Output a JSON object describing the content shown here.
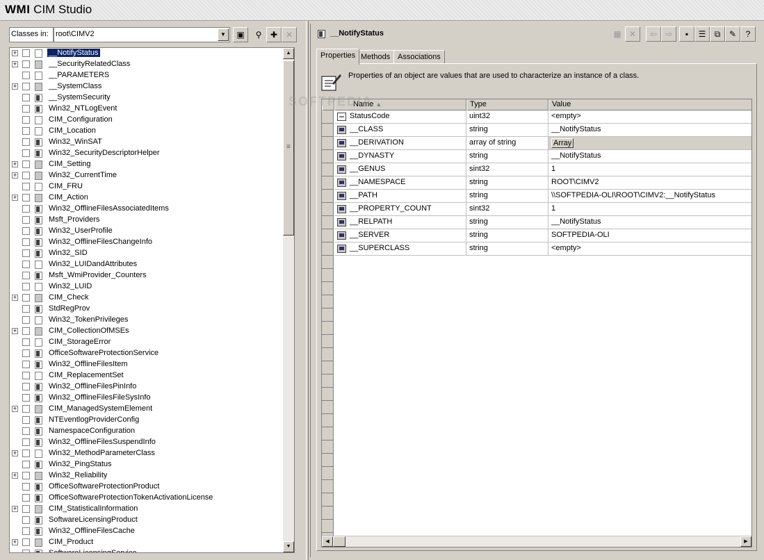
{
  "app": {
    "brand_bold": "WMI",
    "brand_rest": " CIM Studio"
  },
  "left": {
    "classes_label": "Classes in:",
    "namespace": "root\\CIMV2",
    "tree": [
      {
        "label": "__NotifyStatus",
        "expand": true,
        "icon": "plain",
        "selected": true
      },
      {
        "label": "__SecurityRelatedClass",
        "expand": true,
        "icon": "gray"
      },
      {
        "label": "__PARAMETERS",
        "expand": false,
        "icon": "plain"
      },
      {
        "label": "__SystemClass",
        "expand": true,
        "icon": "gray"
      },
      {
        "label": "__SystemSecurity",
        "expand": false,
        "icon": "filled"
      },
      {
        "label": "Win32_NTLogEvent",
        "expand": false,
        "icon": "filled"
      },
      {
        "label": "CIM_Configuration",
        "expand": false,
        "icon": "plain"
      },
      {
        "label": "CIM_Location",
        "expand": false,
        "icon": "plain"
      },
      {
        "label": "Win32_WinSAT",
        "expand": false,
        "icon": "filled"
      },
      {
        "label": "Win32_SecurityDescriptorHelper",
        "expand": false,
        "icon": "filled"
      },
      {
        "label": "CIM_Setting",
        "expand": true,
        "icon": "gray"
      },
      {
        "label": "Win32_CurrentTime",
        "expand": true,
        "icon": "gray"
      },
      {
        "label": "CIM_FRU",
        "expand": false,
        "icon": "plain"
      },
      {
        "label": "CIM_Action",
        "expand": true,
        "icon": "gray"
      },
      {
        "label": "Win32_OfflineFilesAssociatedItems",
        "expand": false,
        "icon": "filled"
      },
      {
        "label": "Msft_Providers",
        "expand": false,
        "icon": "filled"
      },
      {
        "label": "Win32_UserProfile",
        "expand": false,
        "icon": "filled"
      },
      {
        "label": "Win32_OfflineFilesChangeInfo",
        "expand": false,
        "icon": "filled"
      },
      {
        "label": "Win32_SID",
        "expand": false,
        "icon": "filled"
      },
      {
        "label": "Win32_LUIDandAttributes",
        "expand": false,
        "icon": "plain"
      },
      {
        "label": "Msft_WmiProvider_Counters",
        "expand": false,
        "icon": "filled"
      },
      {
        "label": "Win32_LUID",
        "expand": false,
        "icon": "plain"
      },
      {
        "label": "CIM_Check",
        "expand": true,
        "icon": "gray"
      },
      {
        "label": "StdRegProv",
        "expand": false,
        "icon": "filled"
      },
      {
        "label": "Win32_TokenPrivileges",
        "expand": false,
        "icon": "plain"
      },
      {
        "label": "CIM_CollectionOfMSEs",
        "expand": true,
        "icon": "gray"
      },
      {
        "label": "CIM_StorageError",
        "expand": false,
        "icon": "plain"
      },
      {
        "label": "OfficeSoftwareProtectionService",
        "expand": false,
        "icon": "filled"
      },
      {
        "label": "Win32_OfflineFilesItem",
        "expand": false,
        "icon": "filled"
      },
      {
        "label": "CIM_ReplacementSet",
        "expand": false,
        "icon": "plain"
      },
      {
        "label": "Win32_OfflineFilesPinInfo",
        "expand": false,
        "icon": "filled"
      },
      {
        "label": "Win32_OfflineFilesFileSysInfo",
        "expand": false,
        "icon": "filled"
      },
      {
        "label": "CIM_ManagedSystemElement",
        "expand": true,
        "icon": "gray"
      },
      {
        "label": "NTEventlogProviderConfig",
        "expand": false,
        "icon": "filled"
      },
      {
        "label": "NamespaceConfiguration",
        "expand": false,
        "icon": "filled"
      },
      {
        "label": "Win32_OfflineFilesSuspendInfo",
        "expand": false,
        "icon": "filled"
      },
      {
        "label": "Win32_MethodParameterClass",
        "expand": true,
        "icon": "plain"
      },
      {
        "label": "Win32_PingStatus",
        "expand": false,
        "icon": "filled"
      },
      {
        "label": "Win32_Reliability",
        "expand": true,
        "icon": "gray"
      },
      {
        "label": "OfficeSoftwareProtectionProduct",
        "expand": false,
        "icon": "filled"
      },
      {
        "label": "OfficeSoftwareProtectionTokenActivationLicense",
        "expand": false,
        "icon": "filled"
      },
      {
        "label": "CIM_StatisticalInformation",
        "expand": true,
        "icon": "gray"
      },
      {
        "label": "SoftwareLicensingProduct",
        "expand": false,
        "icon": "filled"
      },
      {
        "label": "Win32_OfflineFilesCache",
        "expand": false,
        "icon": "filled"
      },
      {
        "label": "CIM_Product",
        "expand": true,
        "icon": "gray"
      },
      {
        "label": "SoftwareLicensingService",
        "expand": false,
        "icon": "filled"
      }
    ]
  },
  "right": {
    "object_name": "__NotifyStatus",
    "tabs": [
      "Properties",
      "Methods",
      "Associations"
    ],
    "description": "Properties of an object are values that are used to characterize an instance of a class.",
    "columns": [
      "Name",
      "Type",
      "Value"
    ],
    "rows": [
      {
        "name": "StatusCode",
        "type": "uint32",
        "value": "<empty>",
        "icon": "plain"
      },
      {
        "name": "__CLASS",
        "type": "string",
        "value": "__NotifyStatus",
        "icon": "system"
      },
      {
        "name": "__DERIVATION",
        "type": "array of string",
        "value": "Array",
        "icon": "system",
        "is_array": true
      },
      {
        "name": "__DYNASTY",
        "type": "string",
        "value": "__NotifyStatus",
        "icon": "system"
      },
      {
        "name": "__GENUS",
        "type": "sint32",
        "value": "1",
        "icon": "system"
      },
      {
        "name": "__NAMESPACE",
        "type": "string",
        "value": "ROOT\\CIMV2",
        "icon": "system"
      },
      {
        "name": "__PATH",
        "type": "string",
        "value": "\\\\SOFTPEDIA-OLI\\ROOT\\CIMV2:__NotifyStatus",
        "icon": "system"
      },
      {
        "name": "__PROPERTY_COUNT",
        "type": "sint32",
        "value": "1",
        "icon": "system"
      },
      {
        "name": "__RELPATH",
        "type": "string",
        "value": "__NotifyStatus",
        "icon": "system"
      },
      {
        "name": "__SERVER",
        "type": "string",
        "value": "SOFTPEDIA-OLI",
        "icon": "system"
      },
      {
        "name": "__SUPERCLASS",
        "type": "string",
        "value": "<empty>",
        "icon": "system"
      }
    ]
  },
  "icons": {
    "browse": "namespace-browse-icon",
    "search": "binoculars-icon",
    "add": "add-class-icon",
    "delete": "delete-icon"
  },
  "watermark": "SOFTPEDIA"
}
